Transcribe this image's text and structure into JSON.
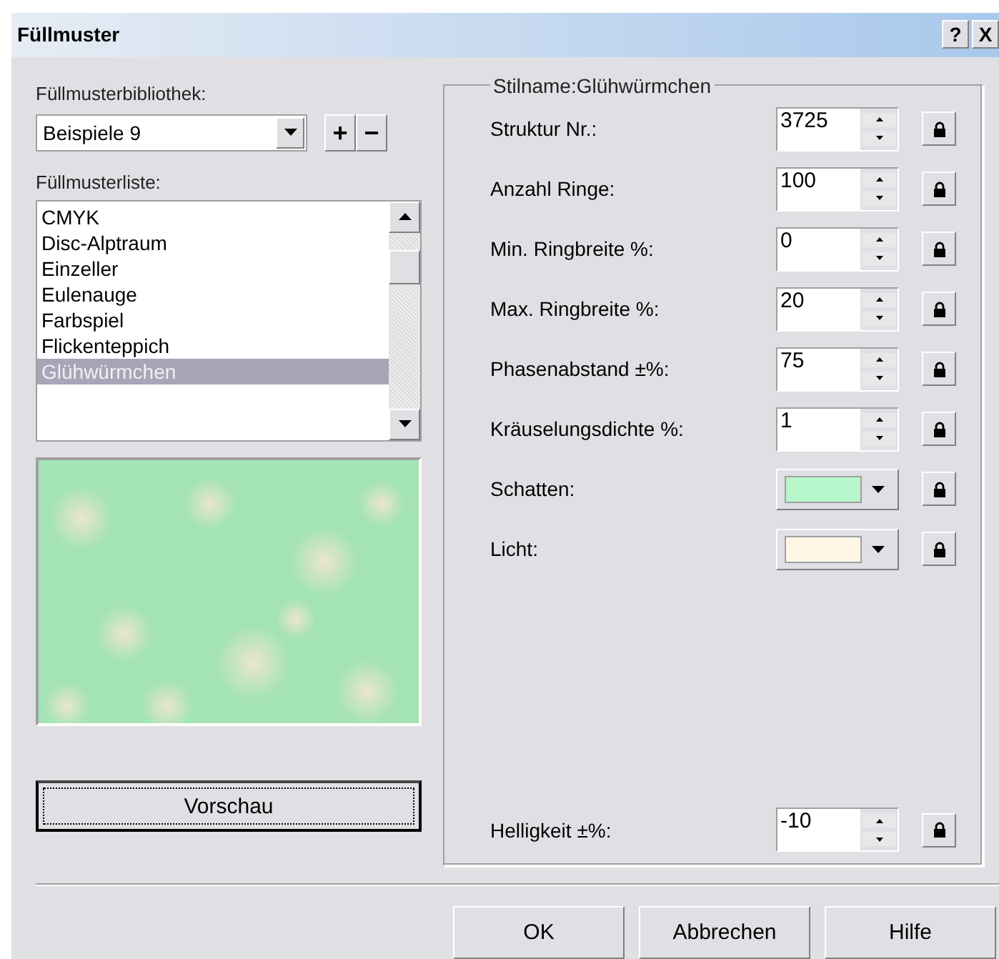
{
  "window": {
    "title": "Füllmuster",
    "help": "?",
    "close": "X"
  },
  "library": {
    "label": "Füllmusterbibliothek:",
    "value": "Beispiele 9",
    "add": "+",
    "remove": "−"
  },
  "list": {
    "label": "Füllmusterliste:",
    "items": [
      {
        "label": "CMYK",
        "selected": false
      },
      {
        "label": "Disc-Alptraum",
        "selected": false
      },
      {
        "label": "Einzeller",
        "selected": false
      },
      {
        "label": "Eulenauge",
        "selected": false
      },
      {
        "label": "Farbspiel",
        "selected": false
      },
      {
        "label": "Flickenteppich",
        "selected": false
      },
      {
        "label": "Glühwürmchen",
        "selected": true
      }
    ]
  },
  "preview": {
    "kind": "picture",
    "button": "Vorschau"
  },
  "style": {
    "title": "Stilname:Glühwürmchen",
    "params": [
      {
        "kind": "spin",
        "label": "Struktur Nr.:",
        "value": "3725"
      },
      {
        "kind": "spin",
        "label": "Anzahl Ringe:",
        "value": "100"
      },
      {
        "kind": "spin",
        "label": "Min. Ringbreite %:",
        "value": "0"
      },
      {
        "kind": "spin",
        "label": "Max. Ringbreite %:",
        "value": "20"
      },
      {
        "kind": "spin",
        "label": "Phasenabstand ±%:",
        "value": "75"
      },
      {
        "kind": "spin",
        "label": "Kräuselungsdichte %:",
        "value": "1"
      },
      {
        "kind": "color",
        "label": "Schatten:",
        "color": "#b8f7cc"
      },
      {
        "kind": "color",
        "label": "Licht:",
        "color": "#fff6e6"
      }
    ],
    "footer": {
      "kind": "spin",
      "label": "Helligkeit ±%:",
      "value": "-10"
    }
  },
  "buttons": [
    "OK",
    "Abbrechen",
    "Hilfe"
  ]
}
